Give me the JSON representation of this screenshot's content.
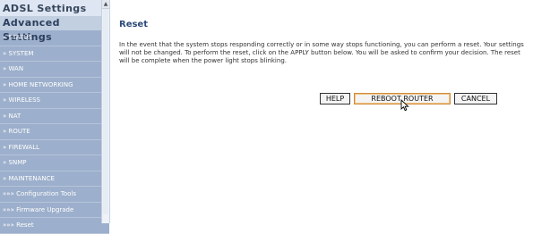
{
  "sidebar": {
    "title": "ADSL Settings",
    "section": "Advanced Settings",
    "items": [
      {
        "label": "» STATUS"
      },
      {
        "label": "» SYSTEM"
      },
      {
        "label": "» WAN"
      },
      {
        "label": "» HOME NETWORKING"
      },
      {
        "label": "» WIRELESS"
      },
      {
        "label": "» NAT"
      },
      {
        "label": "» ROUTE"
      },
      {
        "label": "» FIREWALL"
      },
      {
        "label": "» SNMP"
      },
      {
        "label": "» MAINTENANCE"
      },
      {
        "label": "»»» Configuration Tools"
      },
      {
        "label": "»»» Firmware Upgrade"
      },
      {
        "label": "»»» Reset"
      }
    ]
  },
  "main": {
    "title": "Reset",
    "description": "In the event that the system stops responding correctly or in some way stops functioning, you can perform a reset. Your settings will not be changed. To perform the reset, click on the APPLY button below. You will be asked to confirm your decision. The reset will be complete when the power light stops blinking.",
    "buttons": {
      "help": "HELP",
      "reboot": "REBOOT ROUTER",
      "cancel": "CANCEL"
    }
  },
  "icons": {
    "cursor": "mouse-pointer-icon",
    "scroll_up": "scroll-up-arrow-icon"
  },
  "colors": {
    "sidebar_bg": "#dde6f2",
    "menu_item_bg": "#9cafcc",
    "section_bg": "#c1cfe1",
    "title_color": "#2e4a7a",
    "reboot_border": "#d08b3a"
  }
}
